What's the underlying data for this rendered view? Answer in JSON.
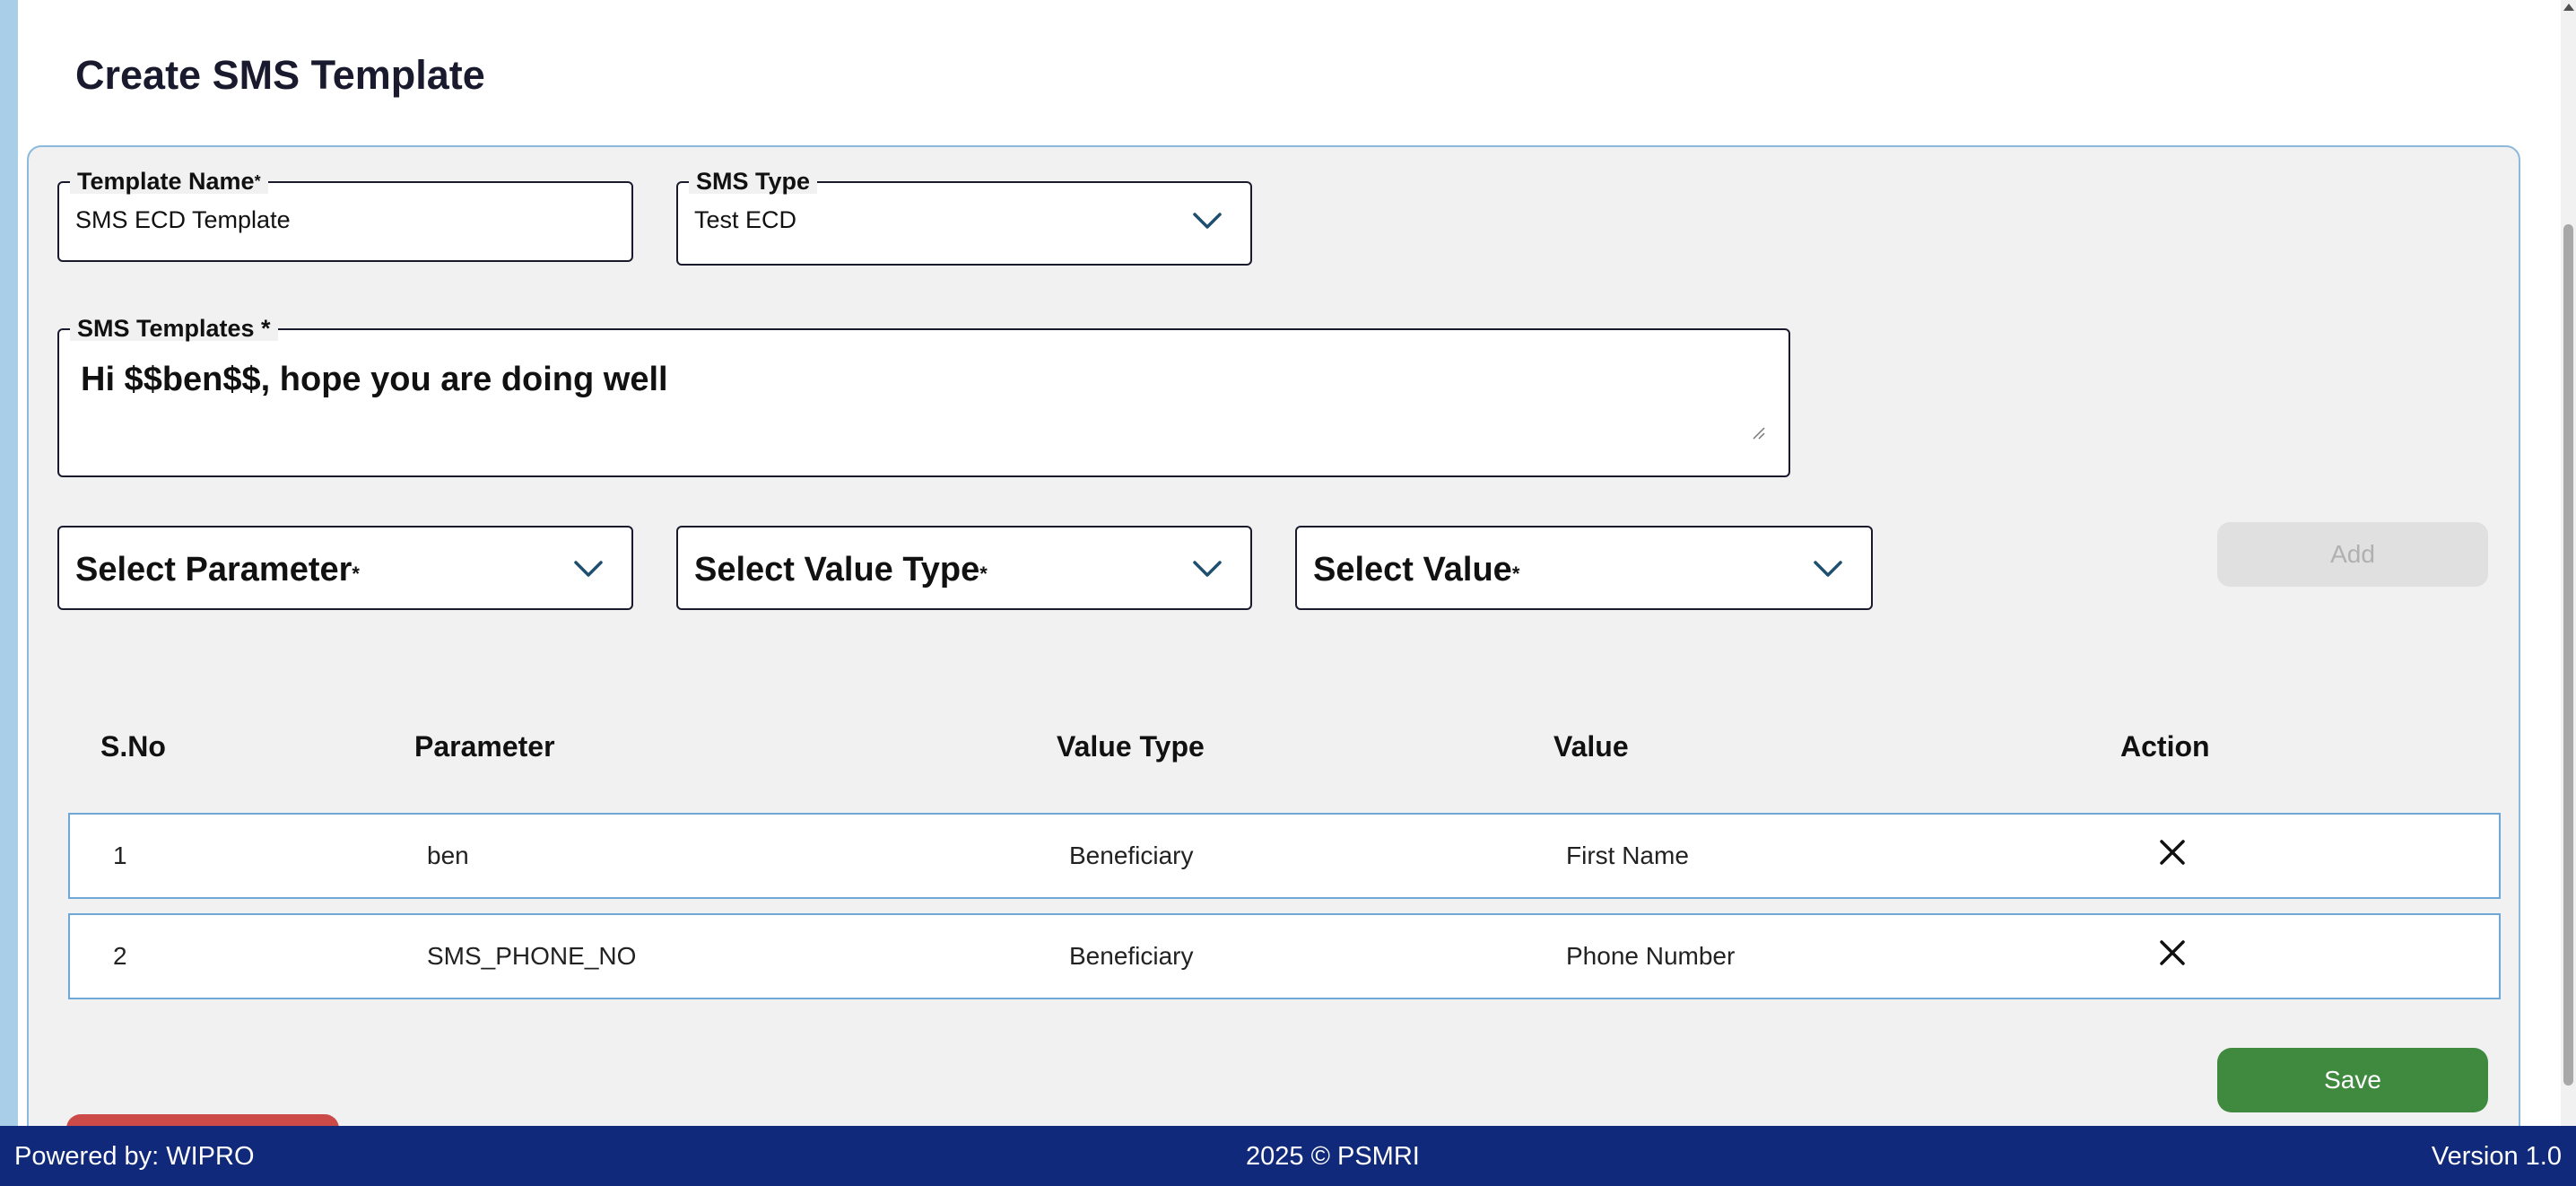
{
  "page": {
    "title": "Create SMS Template"
  },
  "form": {
    "template_name": {
      "label": "Template Name",
      "required_mark": "*",
      "value": "SMS ECD Template"
    },
    "sms_type": {
      "label": "SMS Type",
      "value": "Test ECD"
    },
    "sms_templates": {
      "label": "SMS Templates *",
      "value": "Hi $$ben$$, hope you are doing well"
    },
    "select_parameter": {
      "placeholder": "Select Parameter",
      "required_mark": "*"
    },
    "select_value_type": {
      "placeholder": "Select Value Type",
      "required_mark": "*"
    },
    "select_value": {
      "placeholder": "Select Value",
      "required_mark": "*"
    },
    "add_label": "Add"
  },
  "table": {
    "headers": {
      "sno": "S.No",
      "parameter": "Parameter",
      "value_type": "Value Type",
      "value": "Value",
      "action": "Action"
    },
    "rows": [
      {
        "sno": "1",
        "parameter": "ben",
        "value_type": "Beneficiary",
        "value": "First Name"
      },
      {
        "sno": "2",
        "parameter": "SMS_PHONE_NO",
        "value_type": "Beneficiary",
        "value": "Phone Number"
      }
    ]
  },
  "actions": {
    "save_label": "Save"
  },
  "footer": {
    "powered_by": "Powered by: WIPRO",
    "copyright": "2025 © PSMRI",
    "version": "Version 1.0"
  },
  "icons": {
    "dropdown": "chevron-down-icon",
    "remove": "close-icon",
    "resize": "resize-grip-icon"
  },
  "colors": {
    "footer_bg": "#10297a",
    "save_bg": "#3f8a3f",
    "danger_bg": "#cc4b48",
    "card_border": "#8db9dc",
    "row_border": "#6fa8d6"
  }
}
